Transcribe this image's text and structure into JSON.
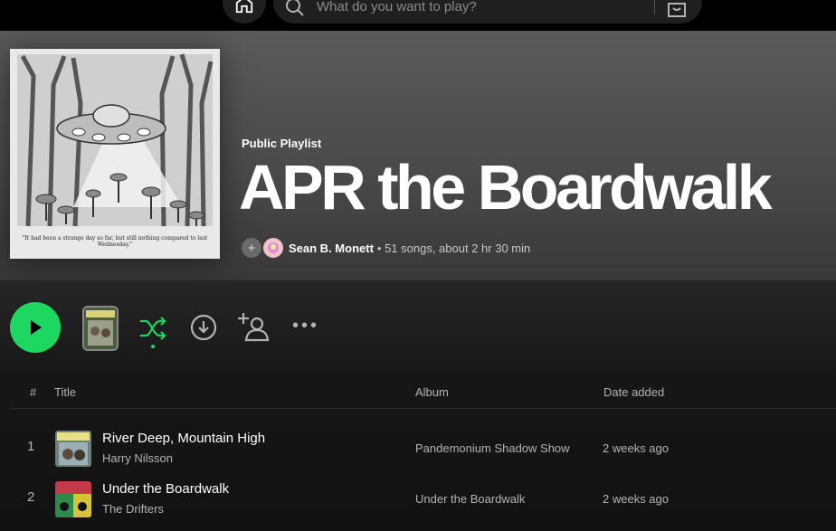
{
  "search": {
    "placeholder": "What do you want to play?"
  },
  "playlist": {
    "type": "Public Playlist",
    "title": "APR the Boardwalk",
    "owner": "Sean B. Monett",
    "stats": "• 51 songs, about 2 hr 30 min",
    "cover_caption": "\"It had been a strange day so far, but still nothing compared to last Wednesday.\""
  },
  "columns": {
    "number": "#",
    "title": "Title",
    "album": "Album",
    "date_added": "Date added"
  },
  "tracks": [
    {
      "number": "1",
      "title": "River Deep, Mountain High",
      "artist": "Harry Nilsson",
      "album": "Pandemonium Shadow Show",
      "date_added": "2 weeks ago"
    },
    {
      "number": "2",
      "title": "Under the Boardwalk",
      "artist": "The Drifters",
      "album": "Under the Boardwalk",
      "date_added": "2 weeks ago"
    }
  ],
  "colors": {
    "accent": "#1ed760",
    "background": "#121212",
    "header": "#5a5a5a"
  },
  "icons": [
    "home-icon",
    "search-icon",
    "browse-icon",
    "plus-icon",
    "play-icon",
    "shuffle-icon",
    "download-icon",
    "add-user-icon",
    "more-icon"
  ]
}
